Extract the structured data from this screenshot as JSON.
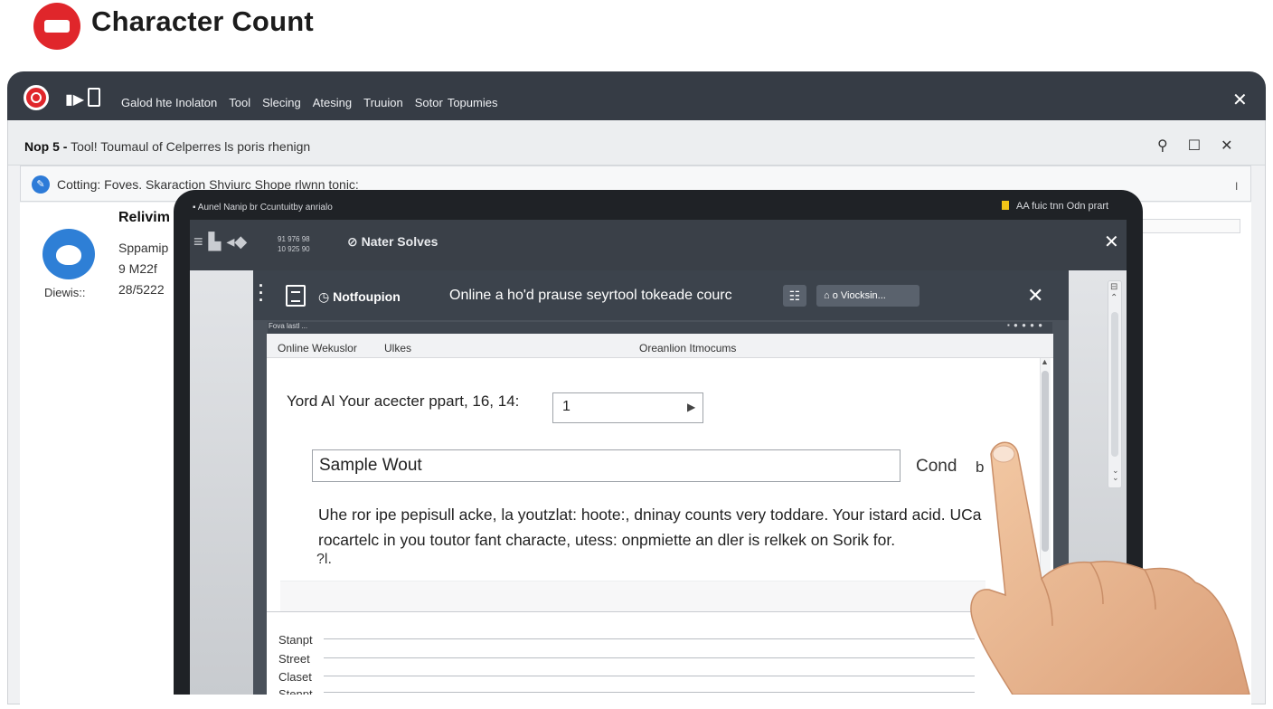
{
  "page": {
    "title": "Character Count"
  },
  "window": {
    "menu": [
      "Galod hte Inolaton",
      "Tool",
      "Slecing",
      "Atesing",
      "Truuion",
      "Sotor",
      "Topumies"
    ],
    "address": {
      "bold": "Nop 5 -",
      "text": "Tool!  Toumaul of Celperres ls poris rhenign"
    },
    "notice": "Cotting: Foves.  Skaraction Shviurc  Shope rlwnn tonic:",
    "notice_end": "I",
    "sidebar": {
      "heading": "Relivim",
      "line1": "Sppamip",
      "line2": "9 M22f",
      "line3": "28/5222",
      "avatar_label": "Diewis::"
    }
  },
  "inner": {
    "status_left": "Aunel  Nanip  br  Ccuntuitby anrialo",
    "status_right": "AA  fuic  tnn Odn prart",
    "mini": [
      "91  976  98",
      "10  925  90"
    ],
    "title": "Nater Solves"
  },
  "dialog": {
    "label": "Notfoupion",
    "title": "Online a ho'd prause seyrtool tokeade courc",
    "button": "o Viocksin...",
    "tiny_text": "Fova lastl  ...",
    "col_headers": [
      "Online Wekuslor",
      "Ulkes",
      "Oreanlion Itmocums"
    ],
    "question": "Yord Al Your acecter ppart, 16, 14:",
    "quantity": "1",
    "sample": "Sample Wout",
    "cond": "Cond",
    "cond_b": "b",
    "paragraph": "Uhe ror ipe pepisull acke, la youtzlat: hoote:, dninay counts very toddare. Your istard acid. UCa rocartelc in you toutor fant characte, utess: onpmiette an dler is relkek on Sorik for.",
    "paragraph_tail": "?l.",
    "list": [
      "Stanpt",
      "Street",
      "Claset",
      "Stenpt"
    ]
  }
}
